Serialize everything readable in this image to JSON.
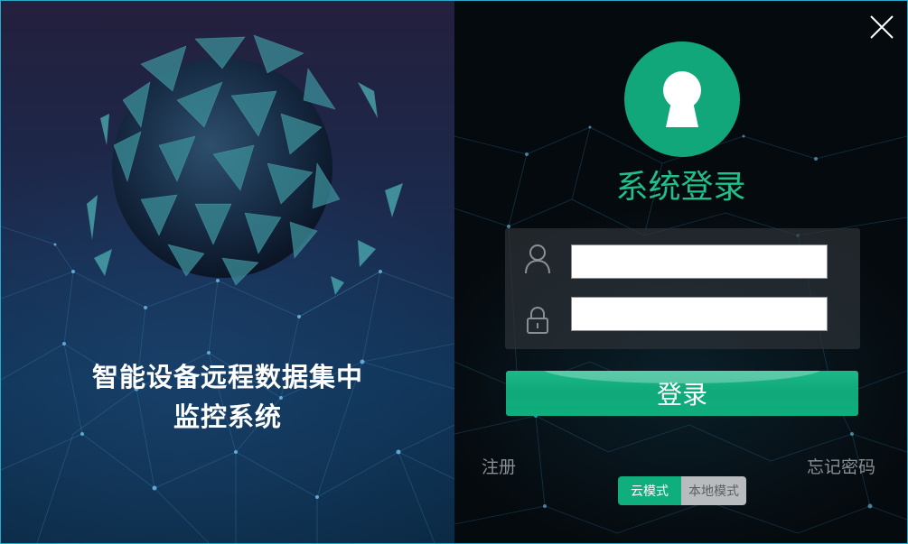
{
  "left_panel": {
    "title_line1": "智能设备远程数据集中",
    "title_line2": "监控系统"
  },
  "login": {
    "title": "系统登录",
    "username_value": "",
    "password_value": "",
    "submit_label": "登录",
    "register_label": "注册",
    "forgot_label": "忘记密码"
  },
  "mode": {
    "cloud_label": "云模式",
    "local_label": "本地模式",
    "selected": "云模式"
  },
  "icons": {
    "close": "close-icon",
    "logo": "keyhole-icon",
    "user": "user-icon",
    "password": "lock-icon"
  },
  "colors": {
    "accent": "#10ad7d",
    "title_green": "#1fc08a",
    "border": "#2aa9c9",
    "link_gray": "#8a8f94"
  }
}
